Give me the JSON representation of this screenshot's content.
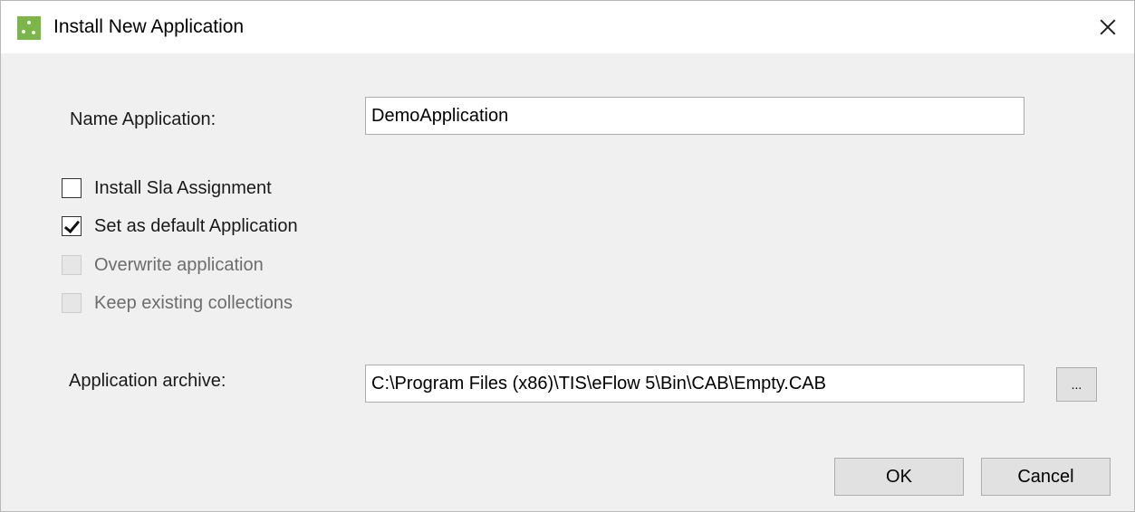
{
  "window": {
    "title": "Install New Application",
    "close_glyph": "close-icon",
    "app_icon": "app-logo-icon",
    "accent_color": "#7ab648"
  },
  "form": {
    "name_label": "Name Application:",
    "name_value": "DemoApplication",
    "archive_label": "Application archive:",
    "archive_value": "C:\\Program Files (x86)\\TIS\\eFlow 5\\Bin\\CAB\\Empty.CAB",
    "browse_label": "..."
  },
  "options": [
    {
      "label": "Install Sla Assignment",
      "checked": false,
      "enabled": true
    },
    {
      "label": "Set as default Application",
      "checked": true,
      "enabled": true
    },
    {
      "label": "Overwrite application",
      "checked": false,
      "enabled": false
    },
    {
      "label": "Keep existing collections",
      "checked": false,
      "enabled": false
    }
  ],
  "buttons": {
    "ok_label": "OK",
    "cancel_label": "Cancel"
  }
}
